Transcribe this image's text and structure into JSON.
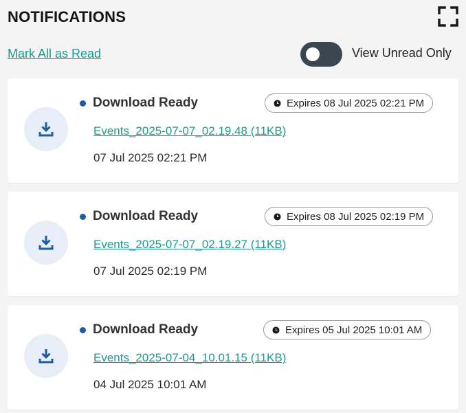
{
  "header": {
    "title": "NOTIFICATIONS"
  },
  "toolbar": {
    "mark_all_label": "Mark All as Read",
    "view_unread_label": "View Unread Only",
    "view_unread_enabled": false
  },
  "notifications": [
    {
      "title": "Download Ready",
      "expires": "Expires 08 Jul 2025 02:21 PM",
      "file": "Events_2025-07-07_02.19.48 (11KB)",
      "timestamp": "07 Jul 2025 02:21 PM",
      "icon": "download-icon",
      "unread": true
    },
    {
      "title": "Download Ready",
      "expires": "Expires 08 Jul 2025 02:19 PM",
      "file": "Events_2025-07-07_02.19.27 (11KB)",
      "timestamp": "07 Jul 2025 02:19 PM",
      "icon": "download-icon",
      "unread": true
    },
    {
      "title": "Download Ready",
      "expires": "Expires 05 Jul 2025 10:01 AM",
      "file": "Events_2025-07-04_10.01.15 (11KB)",
      "timestamp": "04 Jul 2025 10:01 AM",
      "icon": "download-icon",
      "unread": true
    }
  ],
  "colors": {
    "accent_link": "#1a9a8f",
    "unread_dot": "#1f5c9e",
    "icon_blue": "#1f5c9e",
    "icon_bg": "#e7eef8",
    "toggle_bg": "#3b4750"
  }
}
